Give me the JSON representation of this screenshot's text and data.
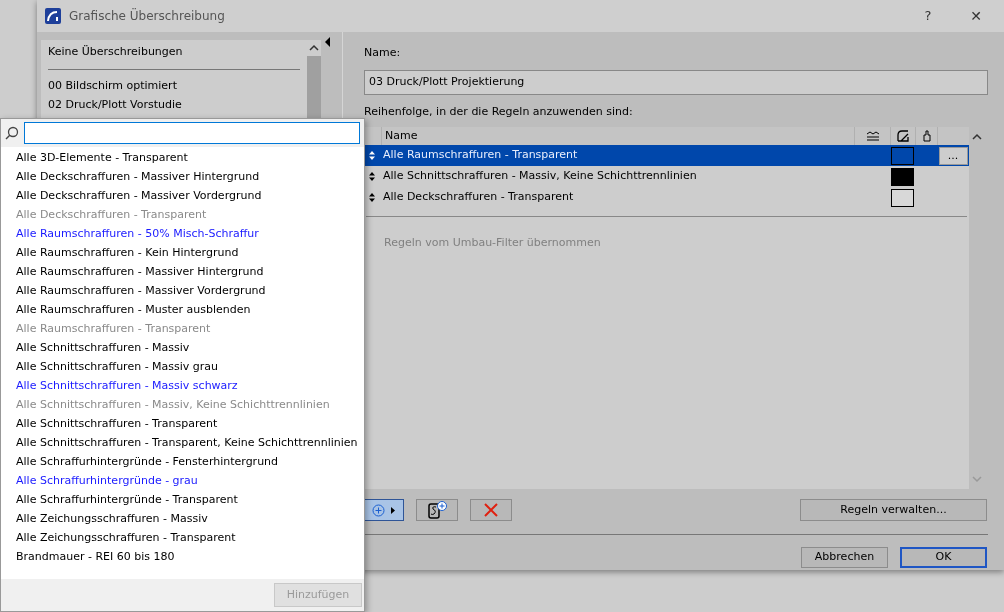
{
  "window": {
    "title": "Grafische Überschreibung",
    "help": "?",
    "close": "✕"
  },
  "styles": {
    "items": [
      {
        "label": "Keine Überschreibungen",
        "kind": "header"
      },
      {
        "label": "00 Bildschirm optimiert",
        "kind": "item"
      },
      {
        "label": "02 Druck/Plott Vorstudie",
        "kind": "item"
      }
    ]
  },
  "name_label": "Name:",
  "name_value": "03 Druck/Plott Projektierung",
  "rules_label": "Reihenfolge, in der die Regeln anzuwenden sind:",
  "rules_table": {
    "columns": [
      "Name"
    ],
    "rows": [
      {
        "name": "Alle Raumschraffuren - Transparent",
        "selected": true,
        "color": "#0047ab",
        "more": "..."
      },
      {
        "name": "Alle Schnittschraffuren - Massiv, Keine Schichttrennlinien",
        "selected": false,
        "color": "#000000"
      },
      {
        "name": "Alle Deckschraffuren - Transparent",
        "selected": false,
        "color": "#d8d8d8"
      }
    ],
    "inherited_label": "Regeln vom Umbau-Filter übernommen"
  },
  "buttons": {
    "manage": "Regeln verwalten...",
    "cancel": "Abbrechen",
    "ok": "OK"
  },
  "popup": {
    "items": [
      {
        "label": "Alle 3D-Elemente - Transparent",
        "kind": "normal"
      },
      {
        "label": "Alle Deckschraffuren - Massiver Hintergrund",
        "kind": "normal"
      },
      {
        "label": "Alle Deckschraffuren - Massiver Vordergrund",
        "kind": "normal"
      },
      {
        "label": "Alle Deckschraffuren - Transparent",
        "kind": "dimmed"
      },
      {
        "label": "Alle Raumschraffuren -  50% Misch-Schraffur",
        "kind": "highlighted"
      },
      {
        "label": "Alle Raumschraffuren - Kein Hintergrund",
        "kind": "normal"
      },
      {
        "label": "Alle Raumschraffuren - Massiver Hintergrund",
        "kind": "normal"
      },
      {
        "label": "Alle Raumschraffuren - Massiver Vordergrund",
        "kind": "normal"
      },
      {
        "label": "Alle Raumschraffuren - Muster ausblenden",
        "kind": "normal"
      },
      {
        "label": "Alle Raumschraffuren - Transparent",
        "kind": "dimmed"
      },
      {
        "label": "Alle Schnittschraffuren - Massiv",
        "kind": "normal"
      },
      {
        "label": "Alle Schnittschraffuren - Massiv grau",
        "kind": "normal"
      },
      {
        "label": "Alle Schnittschraffuren - Massiv schwarz",
        "kind": "highlighted"
      },
      {
        "label": "Alle Schnittschraffuren - Massiv, Keine Schichttrennlinien",
        "kind": "dimmed"
      },
      {
        "label": "Alle Schnittschraffuren - Transparent",
        "kind": "normal"
      },
      {
        "label": "Alle Schnittschraffuren - Transparent, Keine Schichttrennlinien",
        "kind": "normal"
      },
      {
        "label": "Alle Schraffurhintergründe - Fensterhintergrund",
        "kind": "normal"
      },
      {
        "label": "Alle Schraffurhintergründe - grau",
        "kind": "highlighted"
      },
      {
        "label": "Alle Schraffurhintergründe - Transparent",
        "kind": "normal"
      },
      {
        "label": "Alle Zeichungsschraffuren - Massiv",
        "kind": "normal"
      },
      {
        "label": "Alle Zeichungsschraffuren - Transparent",
        "kind": "normal"
      },
      {
        "label": "Brandmauer - REI 60 bis 180",
        "kind": "normal"
      }
    ],
    "add": "Hinzufügen"
  }
}
